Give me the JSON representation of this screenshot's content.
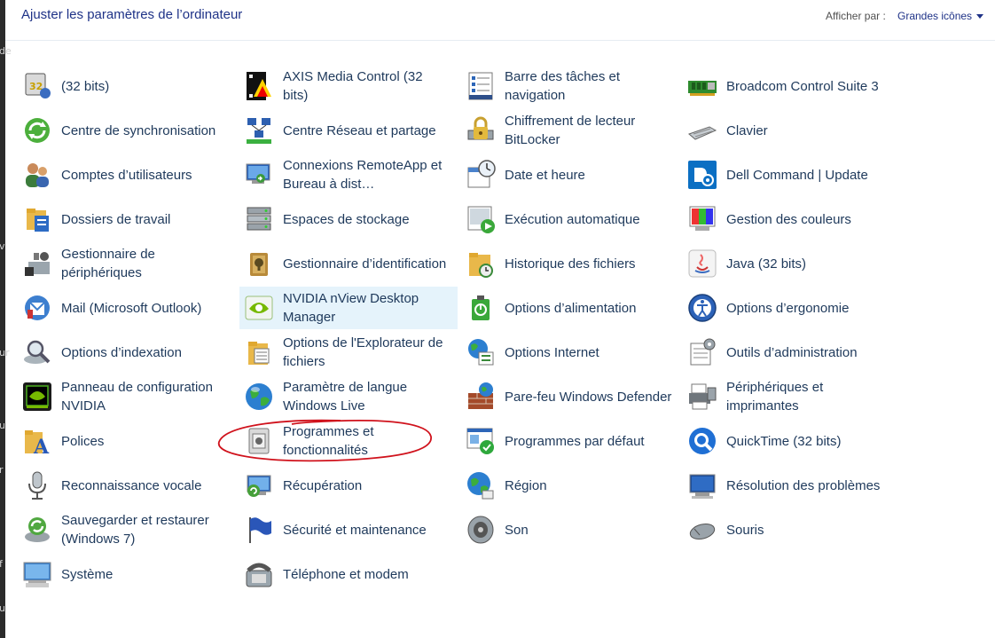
{
  "header": {
    "title": "Ajuster les paramètres de l’ordinateur",
    "view_label": "Afficher par :",
    "view_value": "Grandes icônes"
  },
  "left_strip_chars": [
    "de",
    "v",
    "ur",
    "u",
    "r",
    "f",
    "u"
  ],
  "items": [
    {
      "label": "(32 bits)",
      "icon": "java-32-icon"
    },
    {
      "label": "Centre de synchronisation",
      "icon": "sync-center-icon"
    },
    {
      "label": "Comptes d’utilisateurs",
      "icon": "user-accounts-icon"
    },
    {
      "label": "Dossiers de travail",
      "icon": "work-folders-icon"
    },
    {
      "label": "Gestionnaire de périphériques",
      "icon": "device-manager-icon"
    },
    {
      "label": "Mail (Microsoft Outlook)",
      "icon": "mail-icon"
    },
    {
      "label": "Options d’indexation",
      "icon": "indexing-options-icon"
    },
    {
      "label": "Panneau de configuration NVIDIA",
      "icon": "nvidia-panel-icon"
    },
    {
      "label": "Polices",
      "icon": "fonts-icon"
    },
    {
      "label": "Reconnaissance vocale",
      "icon": "microphone-icon"
    },
    {
      "label": "Sauvegarder et restaurer (Windows 7)",
      "icon": "backup-restore-icon"
    },
    {
      "label": "Système",
      "icon": "system-icon"
    },
    {
      "label": "AXIS Media Control (32 bits)",
      "icon": "axis-media-icon"
    },
    {
      "label": "Centre Réseau et partage",
      "icon": "network-center-icon"
    },
    {
      "label": "Connexions RemoteApp et Bureau à dist…",
      "icon": "remoteapp-icon"
    },
    {
      "label": "Espaces de stockage",
      "icon": "storage-spaces-icon"
    },
    {
      "label": "Gestionnaire d’identification",
      "icon": "credential-manager-icon"
    },
    {
      "label": "NVIDIA nView Desktop Manager",
      "icon": "nvidia-nview-icon"
    },
    {
      "label": "Options de l'Explorateur de fichiers",
      "icon": "explorer-options-icon"
    },
    {
      "label": "Paramètre de langue Windows Live",
      "icon": "globe-language-icon"
    },
    {
      "label": "Programmes et fonctionnalités",
      "icon": "programs-features-icon"
    },
    {
      "label": "Récupération",
      "icon": "recovery-icon"
    },
    {
      "label": "Sécurité et maintenance",
      "icon": "flag-icon"
    },
    {
      "label": "Téléphone et modem",
      "icon": "phone-modem-icon"
    },
    {
      "label": "Barre des tâches et navigation",
      "icon": "taskbar-icon"
    },
    {
      "label": "Chiffrement de lecteur BitLocker",
      "icon": "bitlocker-icon"
    },
    {
      "label": "Date et heure",
      "icon": "date-time-icon"
    },
    {
      "label": "Exécution automatique",
      "icon": "autoplay-icon"
    },
    {
      "label": "Historique des fichiers",
      "icon": "file-history-icon"
    },
    {
      "label": "Options d’alimentation",
      "icon": "power-options-icon"
    },
    {
      "label": "Options Internet",
      "icon": "internet-options-icon"
    },
    {
      "label": "Pare-feu Windows Defender",
      "icon": "firewall-icon"
    },
    {
      "label": "Programmes par défaut",
      "icon": "default-programs-icon"
    },
    {
      "label": "Région",
      "icon": "region-icon"
    },
    {
      "label": "Son",
      "icon": "speaker-icon"
    },
    {
      "label": "Broadcom Control Suite 3",
      "icon": "broadcom-icon"
    },
    {
      "label": "Clavier",
      "icon": "keyboard-icon"
    },
    {
      "label": "Dell Command | Update",
      "icon": "dell-update-icon"
    },
    {
      "label": "Gestion des couleurs",
      "icon": "color-management-icon"
    },
    {
      "label": "Java (32 bits)",
      "icon": "java-icon"
    },
    {
      "label": "Options d’ergonomie",
      "icon": "ease-of-access-icon"
    },
    {
      "label": "Outils d’administration",
      "icon": "admin-tools-icon"
    },
    {
      "label": "Périphériques et imprimantes",
      "icon": "printer-icon"
    },
    {
      "label": "QuickTime (32 bits)",
      "icon": "quicktime-icon"
    },
    {
      "label": "Résolution des problèmes",
      "icon": "troubleshooting-icon"
    },
    {
      "label": "Souris",
      "icon": "mouse-icon"
    }
  ],
  "hovered_item": "NVIDIA nView Desktop Manager",
  "annotation_color": "#d0121c"
}
